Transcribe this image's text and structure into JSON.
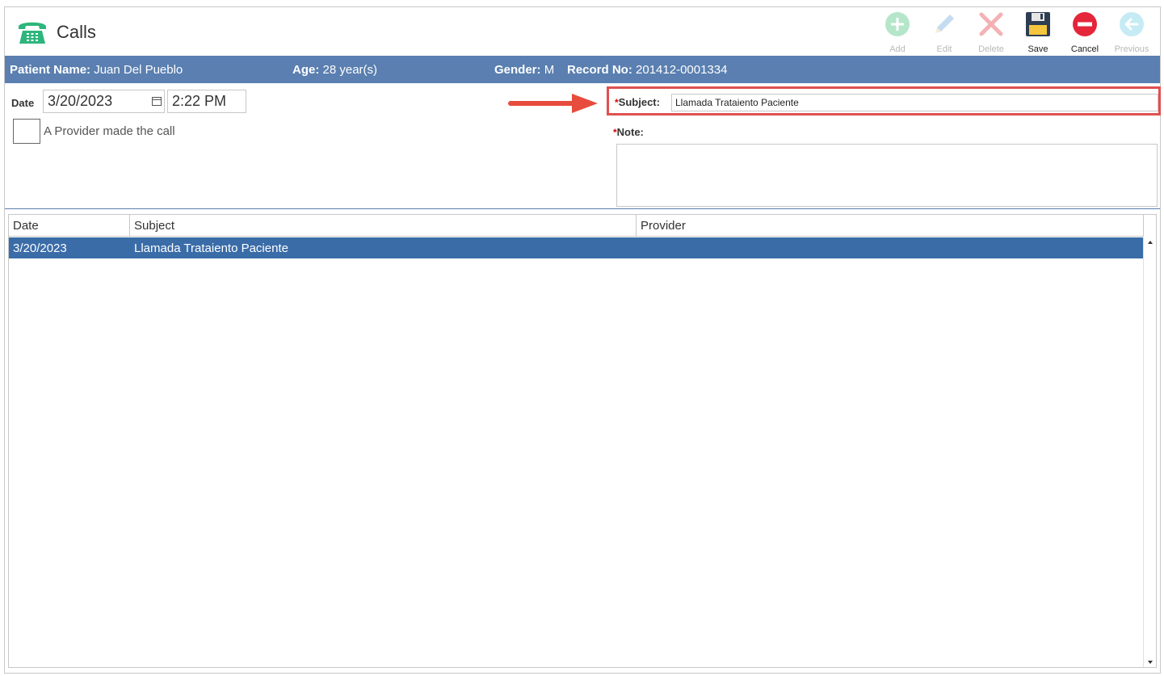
{
  "window": {
    "title": "Calls"
  },
  "toolbar": {
    "add_label": "Add",
    "edit_label": "Edit",
    "delete_label": "Delete",
    "save_label": "Save",
    "cancel_label": "Cancel",
    "previous_label": "Previous"
  },
  "patient": {
    "name_label": "Patient Name:",
    "name_value": "Juan Del Pueblo",
    "age_label": "Age:",
    "age_value": "28 year(s)",
    "gender_label": "Gender:",
    "gender_value": "M",
    "record_label": "Record No:",
    "record_value": "201412-0001334"
  },
  "form": {
    "date_label": "Date",
    "date_value": "3/20/2023",
    "time_value": "2:22 PM",
    "provider_checkbox_label": "A Provider made the call",
    "provider_checked": false,
    "required_marker": "*",
    "subject_label": "Subject:",
    "subject_value": "Llamada Trataiento Paciente",
    "note_label": "Note:",
    "note_value": ""
  },
  "grid": {
    "columns": [
      "Date",
      "Subject",
      "Provider"
    ],
    "rows": [
      {
        "date": "3/20/2023",
        "subject": "Llamada Trataiento Paciente",
        "provider": ""
      }
    ]
  },
  "colors": {
    "patient_bar": "#5a7fb0",
    "selected_row": "#3a6ca8",
    "highlight_box": "#e05050",
    "phone_icon": "#2db67c"
  }
}
